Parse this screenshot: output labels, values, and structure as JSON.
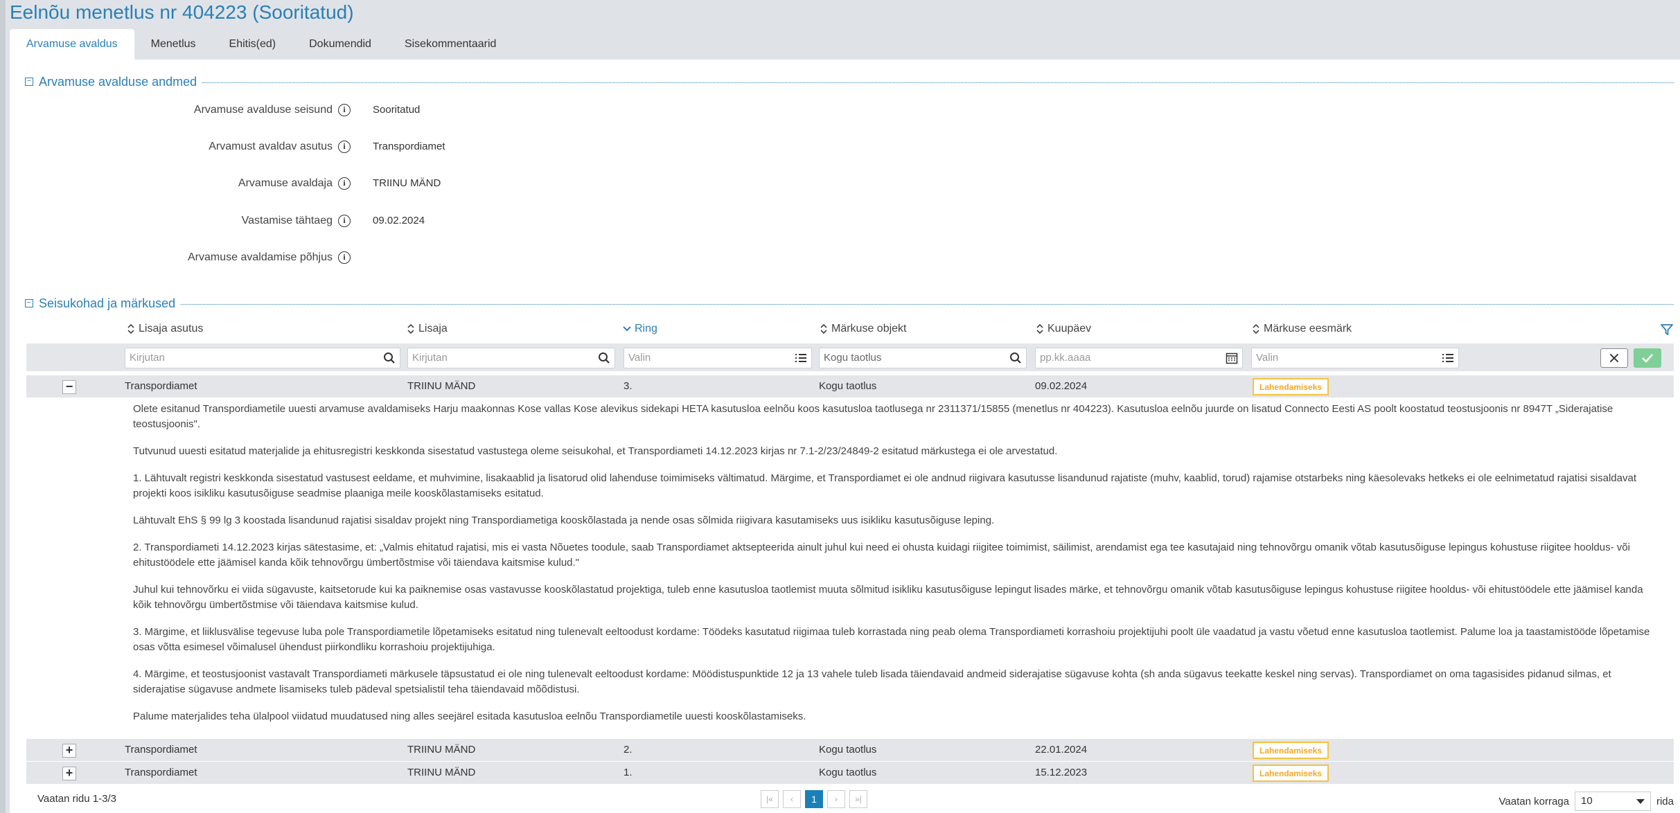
{
  "title": "Eelnõu menetlus nr 404223 (Sooritatud)",
  "tabs": [
    {
      "label": "Arvamuse avaldus"
    },
    {
      "label": "Menetlus"
    },
    {
      "label": "Ehitis(ed)"
    },
    {
      "label": "Dokumendid"
    },
    {
      "label": "Sisekommentaarid"
    }
  ],
  "section1": {
    "title": "Arvamuse avalduse andmed",
    "toggle": "−",
    "fields": [
      {
        "label": "Arvamuse avalduse seisund",
        "value": "Sooritatud"
      },
      {
        "label": "Arvamust avaldav asutus",
        "value": "Transpordiamet"
      },
      {
        "label": "Arvamuse avaldaja",
        "value": "TRIINU MÄND"
      },
      {
        "label": "Vastamise tähtaeg",
        "value": "09.02.2024"
      },
      {
        "label": "Arvamuse avaldamise põhjus",
        "value": ""
      }
    ]
  },
  "section2": {
    "title": "Seisukohad ja märkused",
    "toggle": "−"
  },
  "table": {
    "columns": [
      "Lisaja asutus",
      "Lisaja",
      "Ring",
      "Märkuse objekt",
      "Kuupäev",
      "Märkuse eesmärk"
    ],
    "filters": {
      "lisaja_asutus": "Kirjutan",
      "lisaja": "Kirjutan",
      "ring": "Valin",
      "objekt": "Kogu taotlus",
      "kuupaev": "pp.kk.aaaa",
      "eesmark": "Valin"
    },
    "rows": [
      {
        "toggle": "−",
        "asutus": "Transpordiamet",
        "lisaja": "TRIINU MÄND",
        "ring": "3.",
        "objekt": "Kogu taotlus",
        "kuupaev": "09.02.2024",
        "eesmark": "Lahendamiseks"
      },
      {
        "toggle": "+",
        "asutus": "Transpordiamet",
        "lisaja": "TRIINU MÄND",
        "ring": "2.",
        "objekt": "Kogu taotlus",
        "kuupaev": "22.01.2024",
        "eesmark": "Lahendamiseks"
      },
      {
        "toggle": "+",
        "asutus": "Transpordiamet",
        "lisaja": "TRIINU MÄND",
        "ring": "1.",
        "objekt": "Kogu taotlus",
        "kuupaev": "15.12.2023",
        "eesmark": "Lahendamiseks"
      }
    ],
    "detail": [
      "Olete esitanud Transpordiametile uuesti arvamuse avaldamiseks Harju maakonnas Kose vallas Kose alevikus sidekapi HETA kasutusloa eelnõu koos kasutusloa taotlusega nr 2311371/15855 (menetlus nr 404223). Kasutusloa eelnõu juurde on lisatud Connecto Eesti AS poolt koostatud teostusjoonis nr 8947T „Siderajatise teostusjoonis\".",
      "Tutvunud uuesti esitatud materjalide ja ehitusregistri keskkonda sisestatud vastustega oleme seisukohal, et Transpordiameti 14.12.2023 kirjas nr 7.1-2/23/24849-2 esitatud märkustega ei ole arvestatud.",
      "1. Lähtuvalt registri keskkonda sisestatud vastusest eeldame, et muhvimine, lisakaablid ja lisatorud olid lahenduse toimimiseks vältimatud. Märgime, et Transpordiamet ei ole andnud riigivara kasutusse lisandunud rajatiste (muhv, kaablid, torud) rajamise otstarbeks ning käesolevaks hetkeks ei ole  eelnimetatud rajatisi sisaldavat projekti koos isikliku kasutusõiguse seadmise plaaniga meile kooskõlastamiseks esitatud.",
      "Lähtuvalt EhS § 99 lg 3 koostada lisandunud rajatisi sisaldav projekt ning Transpordiametiga kooskõlastada ja nende osas sõlmida riigivara kasutamiseks uus isikliku kasutusõiguse leping.",
      "2. Transpordiameti 14.12.2023 kirjas sätestasime, et: „Valmis ehitatud rajatisi, mis ei vasta Nõuetes toodule, saab Transpordiamet aktsepteerida ainult juhul kui need ei ohusta kuidagi riigitee toimimist, säilimist, arendamist ega tee kasutajaid ning tehnovõrgu omanik võtab kasutusõiguse lepingus kohustuse riigitee hooldus- või ehitustöödele ette jäämisel kanda kõik tehnovõrgu ümbertõstmise või täiendava kaitsmise kulud.\"",
      "Juhul kui tehnovõrku ei viida sügavuste, kaitsetorude kui ka paiknemise osas vastavusse kooskõlastatud projektiga, tuleb enne kasutusloa taotlemist muuta sõlmitud isikliku kasutusõiguse lepingut lisades märke, et tehnovõrgu omanik võtab kasutusõiguse lepingus kohustuse riigitee hooldus- või ehitustöödele ette jäämisel kanda kõik tehnovõrgu ümbertõstmise või täiendava kaitsmise kulud.",
      "3. Märgime, et liiklusvälise tegevuse luba pole Transpordiametile lõpetamiseks esitatud ning tulenevalt eeltoodust kordame: Töödeks kasutatud riigimaa tuleb korrastada ning peab olema Transpordiameti korrashoiu projektijuhi poolt üle vaadatud ja vastu võetud enne kasutusloa taotlemist. Palume loa ja taastamistööde lõpetamise osas võtta esimesel võimalusel ühendust piirkondliku korrashoiu projektijuhiga.",
      "4. Märgime, et teostusjoonist vastavalt Transpordiameti märkusele täpsustatud ei ole ning tulenevalt eeltoodust kordame: Möödistuspunktide 12 ja 13 vahele tuleb lisada täiendavaid andmeid siderajatise sügavuse kohta (sh anda sügavus teekatte keskel ning servas). Transpordiamet on oma tagasisides pidanud silmas, et siderajatise sügavuse andmete lisamiseks tuleb pädeval spetsialistil teha täiendavaid mõõdistusi.",
      "Palume materjalides teha ülalpool viidatud muudatused ning alles seejärel esitada kasutusloa eelnõu Transpordiametile uuesti kooskõlastamiseks."
    ]
  },
  "footer": {
    "rows_info": "Vaatan ridu 1-3/3",
    "current_page": "1",
    "per_page_label": "Vaatan korraga",
    "per_page_value": "10",
    "per_page_suffix": "rida"
  },
  "colors": {
    "accent": "#2b7fb6",
    "badge": "#f3c340",
    "ok_button": "#7fcf97"
  }
}
